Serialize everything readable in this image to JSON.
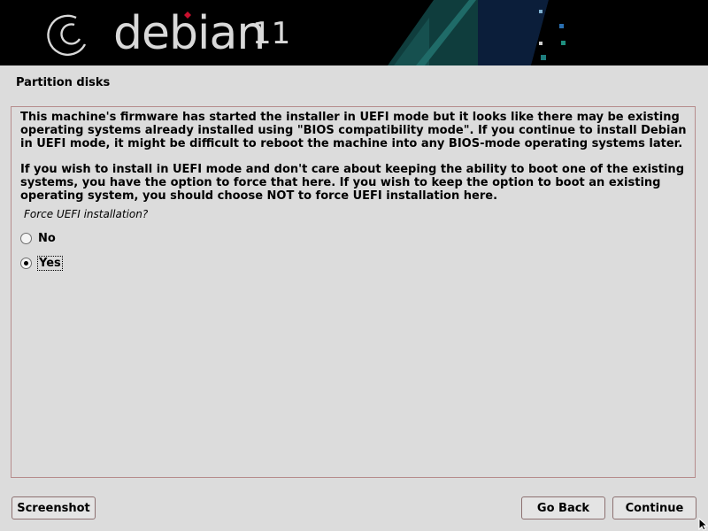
{
  "banner": {
    "logo_text": "debian",
    "version": "11",
    "swirl_icon": "debian-swirl-icon"
  },
  "step_title": "Partition disks",
  "content": {
    "paragraph1": "This machine's firmware has started the installer in UEFI mode but it looks like there may be existing operating systems already installed using \"BIOS compatibility mode\". If you continue to install Debian in UEFI mode, it might be difficult to reboot the machine into any BIOS-mode operating systems later.",
    "paragraph2": "If you wish to install in UEFI mode and don't care about keeping the ability to boot one of the existing systems, you have the option to force that here. If you wish to keep the option to boot an existing operating system, you should choose NOT to force UEFI installation here.",
    "question": "Force UEFI installation?",
    "options": [
      {
        "label": "No",
        "selected": false
      },
      {
        "label": "Yes",
        "selected": true
      }
    ]
  },
  "buttons": {
    "screenshot": "Screenshot",
    "go_back": "Go Back",
    "continue": "Continue"
  },
  "colors": {
    "banner_bg": "#000000",
    "page_bg": "#dcdcdc",
    "panel_border": "#b68c8c",
    "accent_red": "#c8102e",
    "accent_teal": "#1f7d7d"
  }
}
